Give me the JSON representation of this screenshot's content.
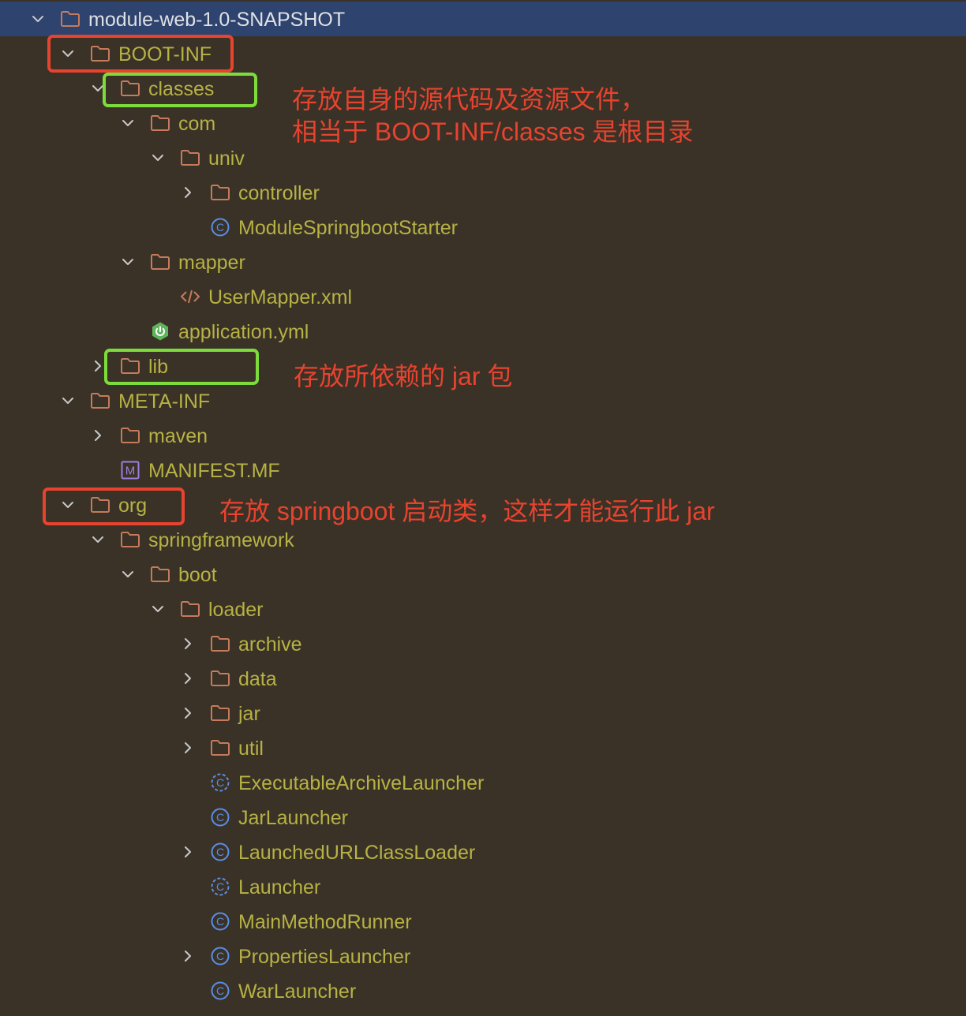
{
  "colors": {
    "background": "#3a3226",
    "selected_row": "#2e436e",
    "label_text": "#b7b245",
    "selected_label_text": "#dfe1e5",
    "folder_icon": "#c57b5c",
    "class_icon": "#5a8de6",
    "spring_icon": "#5fb55c",
    "manifest_icon": "#9f7fdd",
    "red_box": "#e8432f",
    "green_box": "#7cdc3c",
    "annotation_text": "#e8432f"
  },
  "tree": {
    "root": {
      "label": "module-web-1.0-SNAPSHOT",
      "icon": "folder-icon",
      "state": "expanded"
    },
    "boot_inf": {
      "label": "BOOT-INF",
      "icon": "folder-icon",
      "state": "expanded"
    },
    "classes": {
      "label": "classes",
      "icon": "folder-icon",
      "state": "expanded"
    },
    "com": {
      "label": "com",
      "icon": "folder-icon",
      "state": "expanded"
    },
    "univ": {
      "label": "univ",
      "icon": "folder-icon",
      "state": "expanded"
    },
    "controller": {
      "label": "controller",
      "icon": "folder-icon",
      "state": "collapsed"
    },
    "module_starter": {
      "label": "ModuleSpringbootStarter",
      "icon": "class-icon"
    },
    "mapper": {
      "label": "mapper",
      "icon": "folder-icon",
      "state": "expanded"
    },
    "user_mapper": {
      "label": "UserMapper.xml",
      "icon": "xml-icon"
    },
    "application_yml": {
      "label": "application.yml",
      "icon": "spring-boot-icon"
    },
    "lib": {
      "label": "lib",
      "icon": "folder-icon",
      "state": "collapsed"
    },
    "meta_inf": {
      "label": "META-INF",
      "icon": "folder-icon",
      "state": "expanded"
    },
    "maven": {
      "label": "maven",
      "icon": "folder-icon",
      "state": "collapsed"
    },
    "manifest": {
      "label": "MANIFEST.MF",
      "icon": "manifest-icon"
    },
    "org": {
      "label": "org",
      "icon": "folder-icon",
      "state": "expanded"
    },
    "springframework": {
      "label": "springframework",
      "icon": "folder-icon",
      "state": "expanded"
    },
    "boot": {
      "label": "boot",
      "icon": "folder-icon",
      "state": "expanded"
    },
    "loader": {
      "label": "loader",
      "icon": "folder-icon",
      "state": "expanded"
    },
    "archive": {
      "label": "archive",
      "icon": "folder-icon",
      "state": "collapsed"
    },
    "data": {
      "label": "data",
      "icon": "folder-icon",
      "state": "collapsed"
    },
    "jar": {
      "label": "jar",
      "icon": "folder-icon",
      "state": "collapsed"
    },
    "util": {
      "label": "util",
      "icon": "folder-icon",
      "state": "collapsed"
    },
    "executable_archive_launcher": {
      "label": "ExecutableArchiveLauncher",
      "icon": "abstract-class-icon"
    },
    "jar_launcher": {
      "label": "JarLauncher",
      "icon": "class-icon"
    },
    "launched_url_class_loader": {
      "label": "LaunchedURLClassLoader",
      "icon": "class-icon",
      "state": "collapsed"
    },
    "launcher": {
      "label": "Launcher",
      "icon": "abstract-class-icon"
    },
    "main_method_runner": {
      "label": "MainMethodRunner",
      "icon": "class-icon"
    },
    "properties_launcher": {
      "label": "PropertiesLauncher",
      "icon": "class-icon",
      "state": "collapsed"
    },
    "war_launcher": {
      "label": "WarLauncher",
      "icon": "class-icon"
    }
  },
  "annotations": {
    "classes_note_line1": "存放自身的源代码及资源文件，",
    "classes_note_line2": "相当于 BOOT-INF/classes 是根目录",
    "lib_note": "存放所依赖的 jar 包",
    "org_note": "存放 springboot 启动类，这样才能运行此 jar"
  }
}
